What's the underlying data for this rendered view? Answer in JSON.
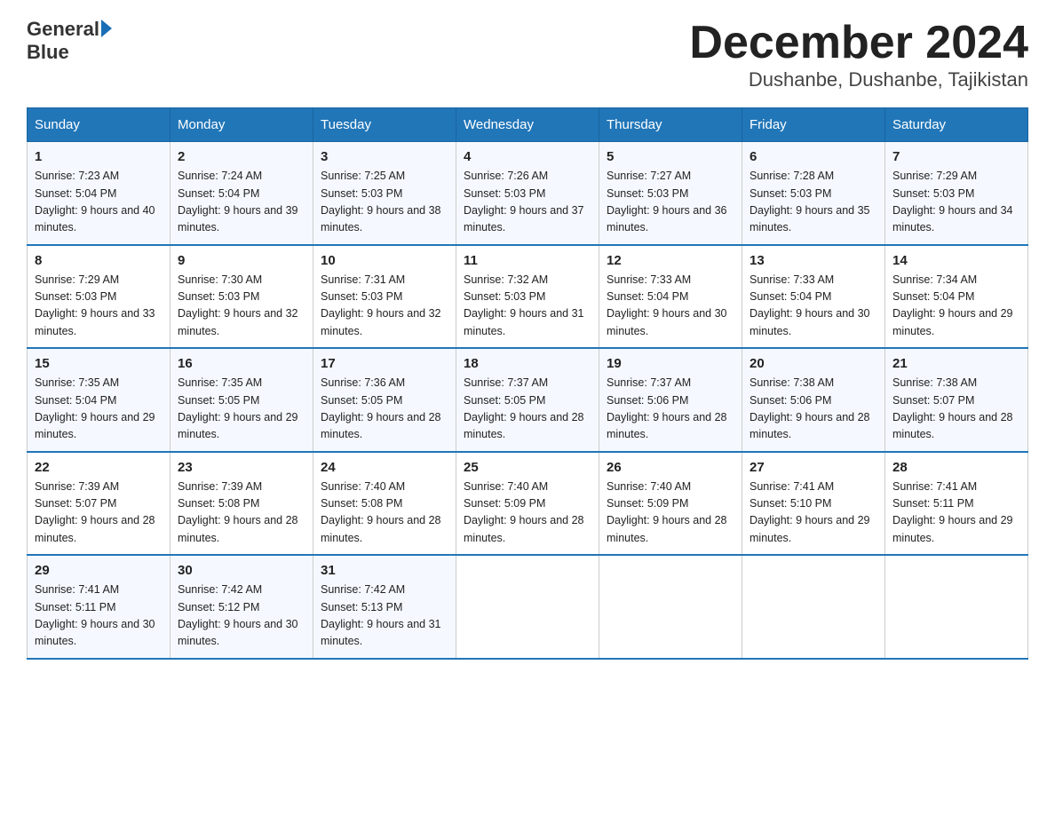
{
  "logo": {
    "text_general": "General",
    "text_blue": "Blue"
  },
  "title": "December 2024",
  "subtitle": "Dushanbe, Dushanbe, Tajikistan",
  "days_of_week": [
    "Sunday",
    "Monday",
    "Tuesday",
    "Wednesday",
    "Thursday",
    "Friday",
    "Saturday"
  ],
  "weeks": [
    [
      {
        "day": "1",
        "sunrise": "7:23 AM",
        "sunset": "5:04 PM",
        "daylight": "9 hours and 40 minutes."
      },
      {
        "day": "2",
        "sunrise": "7:24 AM",
        "sunset": "5:04 PM",
        "daylight": "9 hours and 39 minutes."
      },
      {
        "day": "3",
        "sunrise": "7:25 AM",
        "sunset": "5:03 PM",
        "daylight": "9 hours and 38 minutes."
      },
      {
        "day": "4",
        "sunrise": "7:26 AM",
        "sunset": "5:03 PM",
        "daylight": "9 hours and 37 minutes."
      },
      {
        "day": "5",
        "sunrise": "7:27 AM",
        "sunset": "5:03 PM",
        "daylight": "9 hours and 36 minutes."
      },
      {
        "day": "6",
        "sunrise": "7:28 AM",
        "sunset": "5:03 PM",
        "daylight": "9 hours and 35 minutes."
      },
      {
        "day": "7",
        "sunrise": "7:29 AM",
        "sunset": "5:03 PM",
        "daylight": "9 hours and 34 minutes."
      }
    ],
    [
      {
        "day": "8",
        "sunrise": "7:29 AM",
        "sunset": "5:03 PM",
        "daylight": "9 hours and 33 minutes."
      },
      {
        "day": "9",
        "sunrise": "7:30 AM",
        "sunset": "5:03 PM",
        "daylight": "9 hours and 32 minutes."
      },
      {
        "day": "10",
        "sunrise": "7:31 AM",
        "sunset": "5:03 PM",
        "daylight": "9 hours and 32 minutes."
      },
      {
        "day": "11",
        "sunrise": "7:32 AM",
        "sunset": "5:03 PM",
        "daylight": "9 hours and 31 minutes."
      },
      {
        "day": "12",
        "sunrise": "7:33 AM",
        "sunset": "5:04 PM",
        "daylight": "9 hours and 30 minutes."
      },
      {
        "day": "13",
        "sunrise": "7:33 AM",
        "sunset": "5:04 PM",
        "daylight": "9 hours and 30 minutes."
      },
      {
        "day": "14",
        "sunrise": "7:34 AM",
        "sunset": "5:04 PM",
        "daylight": "9 hours and 29 minutes."
      }
    ],
    [
      {
        "day": "15",
        "sunrise": "7:35 AM",
        "sunset": "5:04 PM",
        "daylight": "9 hours and 29 minutes."
      },
      {
        "day": "16",
        "sunrise": "7:35 AM",
        "sunset": "5:05 PM",
        "daylight": "9 hours and 29 minutes."
      },
      {
        "day": "17",
        "sunrise": "7:36 AM",
        "sunset": "5:05 PM",
        "daylight": "9 hours and 28 minutes."
      },
      {
        "day": "18",
        "sunrise": "7:37 AM",
        "sunset": "5:05 PM",
        "daylight": "9 hours and 28 minutes."
      },
      {
        "day": "19",
        "sunrise": "7:37 AM",
        "sunset": "5:06 PM",
        "daylight": "9 hours and 28 minutes."
      },
      {
        "day": "20",
        "sunrise": "7:38 AM",
        "sunset": "5:06 PM",
        "daylight": "9 hours and 28 minutes."
      },
      {
        "day": "21",
        "sunrise": "7:38 AM",
        "sunset": "5:07 PM",
        "daylight": "9 hours and 28 minutes."
      }
    ],
    [
      {
        "day": "22",
        "sunrise": "7:39 AM",
        "sunset": "5:07 PM",
        "daylight": "9 hours and 28 minutes."
      },
      {
        "day": "23",
        "sunrise": "7:39 AM",
        "sunset": "5:08 PM",
        "daylight": "9 hours and 28 minutes."
      },
      {
        "day": "24",
        "sunrise": "7:40 AM",
        "sunset": "5:08 PM",
        "daylight": "9 hours and 28 minutes."
      },
      {
        "day": "25",
        "sunrise": "7:40 AM",
        "sunset": "5:09 PM",
        "daylight": "9 hours and 28 minutes."
      },
      {
        "day": "26",
        "sunrise": "7:40 AM",
        "sunset": "5:09 PM",
        "daylight": "9 hours and 28 minutes."
      },
      {
        "day": "27",
        "sunrise": "7:41 AM",
        "sunset": "5:10 PM",
        "daylight": "9 hours and 29 minutes."
      },
      {
        "day": "28",
        "sunrise": "7:41 AM",
        "sunset": "5:11 PM",
        "daylight": "9 hours and 29 minutes."
      }
    ],
    [
      {
        "day": "29",
        "sunrise": "7:41 AM",
        "sunset": "5:11 PM",
        "daylight": "9 hours and 30 minutes."
      },
      {
        "day": "30",
        "sunrise": "7:42 AM",
        "sunset": "5:12 PM",
        "daylight": "9 hours and 30 minutes."
      },
      {
        "day": "31",
        "sunrise": "7:42 AM",
        "sunset": "5:13 PM",
        "daylight": "9 hours and 31 minutes."
      },
      null,
      null,
      null,
      null
    ]
  ]
}
